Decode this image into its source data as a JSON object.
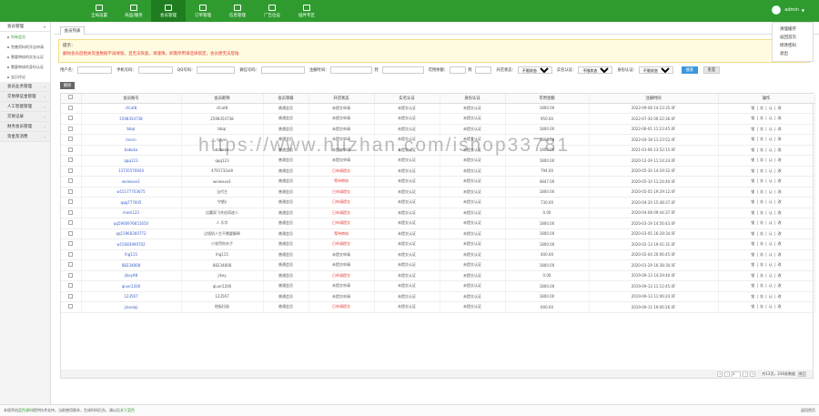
{
  "topnav": [
    {
      "label": "全局设置",
      "icon": "grid-icon"
    },
    {
      "label": "商品/服务",
      "icon": "user-icon"
    },
    {
      "label": "会员管理",
      "icon": "list-icon",
      "active": true
    },
    {
      "label": "订单管理",
      "icon": "cart-icon"
    },
    {
      "label": "信息管理",
      "icon": "info-icon"
    },
    {
      "label": "广告位设",
      "icon": "gear-icon"
    },
    {
      "label": "插件专区",
      "icon": "bag-icon"
    }
  ],
  "user": {
    "name": "admin"
  },
  "dropdown": [
    "清理缓存",
    "返回首页",
    "修改密码",
    "退出"
  ],
  "sidebar": {
    "groups": [
      {
        "label": "会员管理",
        "open": true,
        "items": [
          "所有会员",
          "完善资料的开店申请",
          "需要审核的实名认证",
          "需要审核的身份认证",
          "宝贝评论"
        ]
      },
      {
        "label": "会员业务管理"
      },
      {
        "label": "交易保证金管理"
      },
      {
        "label": "人工智能管理"
      },
      {
        "label": "交易记录"
      },
      {
        "label": "财务会员管理"
      },
      {
        "label": "资金及消费"
      }
    ]
  },
  "tab": "会员列表",
  "notice": {
    "line1": "提示：",
    "line2": "删除会员后相关资金数据不再保留，且无法恢复，请谨慎，如需停用请选择锁定，会员便无法登陆"
  },
  "filters": {
    "account": "用户名：",
    "phone": "手机号码：",
    "qq": "QQ号码：",
    "wechat": "微信号码：",
    "regtime": "注册时间：",
    "to": "到",
    "balance": "可用余额：",
    "to2": "到",
    "opened": "开店状态：",
    "opened_value": "不限状态",
    "realname": "实名认证：",
    "realname_value": "不限状态",
    "identity": "身份认证：",
    "identity_value": "不限状态",
    "search_btn": "搜索",
    "reset_btn": "重置"
  },
  "delete_btn": "删除",
  "table": {
    "headers": [
      "",
      "会员账号",
      "会员昵称",
      "会员等级",
      "开店状态",
      "实名认证",
      "身份认证",
      "可用金额",
      "注册时间",
      "操作"
    ],
    "rows": [
      [
        "cfcat8",
        "cfcat8",
        "普通会员",
        "未提交申请",
        "未提交认证",
        "未提交认证",
        "1800.00",
        "2022-09-08 14:23:35.0F"
      ],
      [
        "2598354738",
        "2598354738",
        "普通会员",
        "未提交申请",
        "未提交认证",
        "未提交认证",
        "950.00",
        "2022-07-30 00:22:36.0F"
      ],
      [
        "bbqr",
        "bbqr",
        "普通会员",
        "未提交申请",
        "未提交认证",
        "未提交认证",
        "1800.00",
        "2022-06-01 11:23:45.0F"
      ],
      [
        "lnnnn",
        "lnnnn",
        "普通会员",
        "未提交申请",
        "未提交认证",
        "未提交认证",
        "1800.00",
        "2022-04-18 11:23:52.0F"
      ],
      [
        "babaka",
        "babaka",
        "普通会员",
        "未提交申请",
        "未提交认证",
        "未提交认证",
        "1800.00",
        "2021-01-06 13:52:15.0F"
      ],
      [
        "qqq123",
        "qqq123",
        "普通会员",
        "未提交申请",
        "未提交认证",
        "未提交认证",
        "1800.00",
        "2020-12-29 11:14:24.0F"
      ],
      [
        "13735576920",
        "4791732xl8",
        "普通会员",
        "已申请提交",
        "未提交认证",
        "未提交认证",
        "794.00",
        "2020-05-30 14:29:32.0F"
      ],
      [
        "weiwave1",
        "weiwave1",
        "普通会员",
        "等待审核",
        "未提交认证",
        "未提交认证",
        "4847.00",
        "2020-05-10 11:24:40.0F"
      ],
      [
        "w15177703675",
        "当代主",
        "普通会员",
        "已申请提交",
        "未提交认证",
        "未提交认证",
        "1800.00",
        "2020-05-05 19:29:12.0F"
      ],
      [
        "qqq777005",
        "守望y",
        "普通会员",
        "已申请提交",
        "未提交认证",
        "未提交认证",
        "730.00",
        "2020-04-20 15:48:37.0F"
      ],
      [
        "mam123",
        "比翼双飞共创奇迹人",
        "普通会员",
        "已申请提交",
        "未提交认证",
        "未提交认证",
        "0.00",
        "2020-04-08 09:44:37.0F"
      ],
      [
        "qq5960976651650",
        "人 乐华",
        "普通会员",
        "已申请提交",
        "未提交认证",
        "未提交认证",
        "1800.00",
        "2020-03-19 14:56:43.0F"
      ],
      [
        "qq15960260772",
        "过境奶人生不需要解释",
        "普通会员",
        "等待审核",
        "未提交认证",
        "未提交认证",
        "1800.00",
        "2020-03-05 16:28:34.0F"
      ],
      [
        "w15083990702",
        "小张罚你夫子",
        "普通会员",
        "已申请提交",
        "未提交认证",
        "未提交认证",
        "1800.00",
        "2020-02-13 19:41:31.0F"
      ],
      [
        "lhg115",
        "lhg115",
        "普通会员",
        "未提交申请",
        "未提交认证",
        "未提交认证",
        "400.00",
        "2020-02-04 20:06:45.0F"
      ],
      [
        "88234808",
        "88234808",
        "普通会员",
        "未提交申请",
        "未提交认证",
        "未提交认证",
        "1800.00",
        "2020-01-29 16:38:30.0F"
      ],
      [
        "jikey98",
        "jikey",
        "普通会员",
        "已申请提交",
        "未提交认证",
        "未提交认证",
        "0.00",
        "2019-09-13 14:29:40.0F"
      ],
      [
        "qiuer2200",
        "qiuer2200",
        "普通会员",
        "未提交申请",
        "未提交认证",
        "未提交认证",
        "1800.00",
        "2019-09-13 11:12:45.0F"
      ],
      [
        "123567",
        "123567",
        "普通会员",
        "未提交申请",
        "未提交认证",
        "未提交认证",
        "1800.00",
        "2019-09-13 11:06:24.0F"
      ],
      [
        "jinselaji",
        "地板拉圾",
        "普通会员",
        "已申请提交",
        "未提交认证",
        "未提交认证",
        "600.00",
        "2019-09-11 19:06:26.0F"
      ]
    ],
    "ops": [
      "锁",
      "冻",
      "认",
      "改"
    ]
  },
  "pager": {
    "current": "1",
    "info": "共13页，236条数据",
    "go": "确定"
  },
  "watermark": "https://www.huzhan.com/ishop33781",
  "footer": {
    "text1": "本程序由",
    "text2": "蓝色源码",
    "text3": "提供技术支持，当前使用版本，生成时间后台，请以后",
    "text4": "关于蓝色",
    "right": "返回首页"
  }
}
